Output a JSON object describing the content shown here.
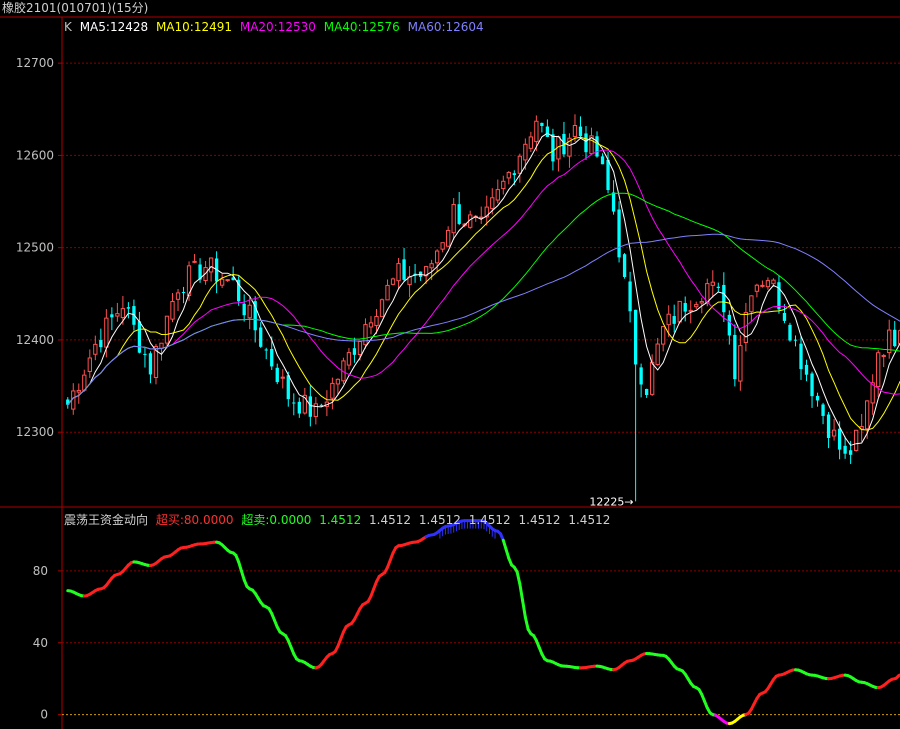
{
  "window": {
    "title": "橡胶2101(010701)(15分)"
  },
  "main_legend": {
    "k_label": "K",
    "ma5": "MA5:12428",
    "ma10": "MA10:12491",
    "ma20": "MA20:12530",
    "ma40": "MA40:12576",
    "ma60": "MA60:12604"
  },
  "indicator_legend": {
    "name": "震荡王资金动向",
    "overbought": "超买:80.0000",
    "oversold": "超卖:0.0000",
    "v1": "1.4512",
    "v2": "1.4512",
    "v3": "1.4512",
    "v4": "1.4512",
    "v5": "1.4512",
    "v6": "1.4512"
  },
  "colors": {
    "background": "#000000",
    "frame": "#b00000",
    "grid": "#8b0000",
    "up": "#ff5050",
    "down": "#00ffff",
    "ma5": "#ffffff",
    "ma10": "#ffff00",
    "ma20": "#ff00ff",
    "ma40": "#00ff00",
    "ma60": "#8080ff",
    "ind_up": "#ff2020",
    "ind_down": "#20ff20",
    "ind_top": "#3030ff",
    "ind_bottom": "#ff00ff",
    "ind_yellow": "#ffff00"
  },
  "chart_data": [
    {
      "type": "candlestick",
      "ylim": [
        12220,
        12750
      ],
      "yticks": [
        12300,
        12400,
        12500,
        12600,
        12700
      ],
      "low_annotation": {
        "label": "12225",
        "value": 12225
      },
      "key_closes": [
        {
          "bar": 0,
          "close": 12330
        },
        {
          "bar": 5,
          "close": 12395
        },
        {
          "bar": 10,
          "close": 12440
        },
        {
          "bar": 15,
          "close": 12370
        },
        {
          "bar": 20,
          "close": 12460
        },
        {
          "bar": 25,
          "close": 12480
        },
        {
          "bar": 30,
          "close": 12460
        },
        {
          "bar": 35,
          "close": 12400
        },
        {
          "bar": 40,
          "close": 12340
        },
        {
          "bar": 45,
          "close": 12320
        },
        {
          "bar": 50,
          "close": 12370
        },
        {
          "bar": 55,
          "close": 12430
        },
        {
          "bar": 60,
          "close": 12470
        },
        {
          "bar": 65,
          "close": 12470
        },
        {
          "bar": 70,
          "close": 12540
        },
        {
          "bar": 75,
          "close": 12520
        },
        {
          "bar": 80,
          "close": 12580
        },
        {
          "bar": 85,
          "close": 12640
        },
        {
          "bar": 88,
          "close": 12600
        },
        {
          "bar": 92,
          "close": 12630
        },
        {
          "bar": 96,
          "close": 12600
        },
        {
          "bar": 99,
          "close": 12540
        },
        {
          "bar": 101,
          "close": 12460
        },
        {
          "bar": 103,
          "close": 12380
        },
        {
          "bar": 105,
          "close": 12350
        },
        {
          "bar": 108,
          "close": 12410
        },
        {
          "bar": 112,
          "close": 12440
        },
        {
          "bar": 116,
          "close": 12460
        },
        {
          "bar": 119,
          "close": 12440
        },
        {
          "bar": 121,
          "close": 12370
        },
        {
          "bar": 124,
          "close": 12460
        },
        {
          "bar": 127,
          "close": 12470
        },
        {
          "bar": 130,
          "close": 12430
        },
        {
          "bar": 133,
          "close": 12380
        },
        {
          "bar": 137,
          "close": 12320
        },
        {
          "bar": 141,
          "close": 12270
        },
        {
          "bar": 144,
          "close": 12300
        },
        {
          "bar": 147,
          "close": 12390
        },
        {
          "bar": 151,
          "close": 12410
        }
      ],
      "ma_end": {
        "ma5": 12428,
        "ma10": 12491,
        "ma20": 12530,
        "ma40": 12576,
        "ma60": 12604
      }
    },
    {
      "type": "line",
      "name": "震荡王资金动向",
      "ylim": [
        -8,
        115
      ],
      "yticks": [
        0,
        40,
        80
      ],
      "x": [
        0,
        3,
        6,
        9,
        12,
        15,
        18,
        21,
        24,
        27,
        30,
        33,
        36,
        39,
        42,
        45,
        48,
        51,
        54,
        57,
        60,
        63,
        66,
        69,
        72,
        75,
        78,
        81,
        84,
        87,
        90,
        93,
        96,
        99,
        102,
        105,
        108,
        111,
        114,
        117,
        120,
        123,
        126,
        129,
        132,
        135,
        138,
        141,
        144,
        147,
        150,
        151
      ],
      "y": [
        69,
        66,
        70,
        78,
        85,
        83,
        88,
        93,
        95,
        96,
        90,
        70,
        60,
        45,
        30,
        26,
        34,
        50,
        62,
        78,
        94,
        96,
        100,
        105,
        108,
        108,
        102,
        82,
        45,
        30,
        27,
        26,
        27,
        25,
        30,
        34,
        33,
        25,
        15,
        0,
        -5,
        0,
        12,
        22,
        25,
        22,
        20,
        22,
        18,
        15,
        20,
        22
      ]
    }
  ]
}
